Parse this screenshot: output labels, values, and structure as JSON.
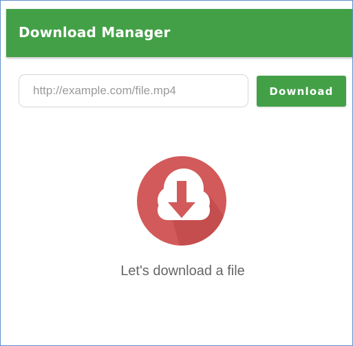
{
  "app_bar": {
    "title": "Download Manager"
  },
  "form": {
    "url_placeholder": "http://example.com/file.mp4",
    "url_value": "",
    "download_label": "Download"
  },
  "empty_state": {
    "icon": "cloud-download-icon",
    "message": "Let's download a file"
  },
  "colors": {
    "primary": "#43a047",
    "icon_background": "#d35a5a",
    "text": "#666666",
    "placeholder": "#9a9a9a",
    "window_border": "#5f8fc9"
  }
}
